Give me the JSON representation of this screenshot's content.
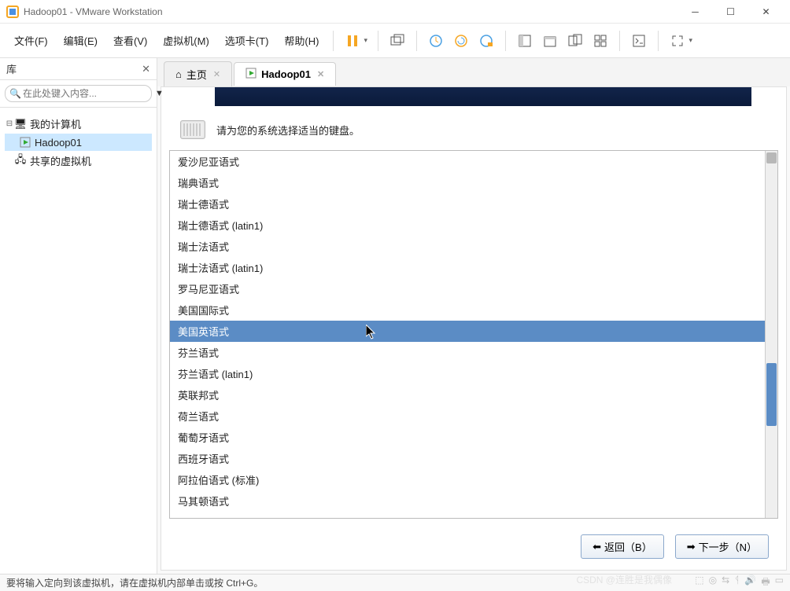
{
  "window": {
    "title": "Hadoop01 - VMware Workstation"
  },
  "menu": {
    "file": "文件(F)",
    "edit": "编辑(E)",
    "view": "查看(V)",
    "vm": "虚拟机(M)",
    "tabs": "选项卡(T)",
    "help": "帮助(H)"
  },
  "sidebar": {
    "title": "库",
    "search_placeholder": "在此处键入内容...",
    "tree": {
      "mycomputer": "我的计算机",
      "vm1": "Hadoop01",
      "shared": "共享的虚拟机"
    }
  },
  "tabs": {
    "home": "主页",
    "vm1": "Hadoop01"
  },
  "vm": {
    "prompt": "请为您的系统选择适当的键盘。",
    "keyboards": [
      "爱沙尼亚语式",
      "瑞典语式",
      "瑞士德语式",
      "瑞士德语式 (latin1)",
      "瑞士法语式",
      "瑞士法语式 (latin1)",
      "罗马尼亚语式",
      "美国国际式",
      "美国英语式",
      "芬兰语式",
      "芬兰语式 (latin1)",
      "英联邦式",
      "荷兰语式",
      "葡萄牙语式",
      "西班牙语式",
      "阿拉伯语式 (标准)",
      "马其顿语式"
    ],
    "selected_index": 8,
    "back": "返回（B）",
    "next": "下一步（N）"
  },
  "status": {
    "text": "要将输入定向到该虚拟机，请在虚拟机内部单击或按 Ctrl+G。"
  },
  "watermark": "CSDN @连胜是我偶像"
}
